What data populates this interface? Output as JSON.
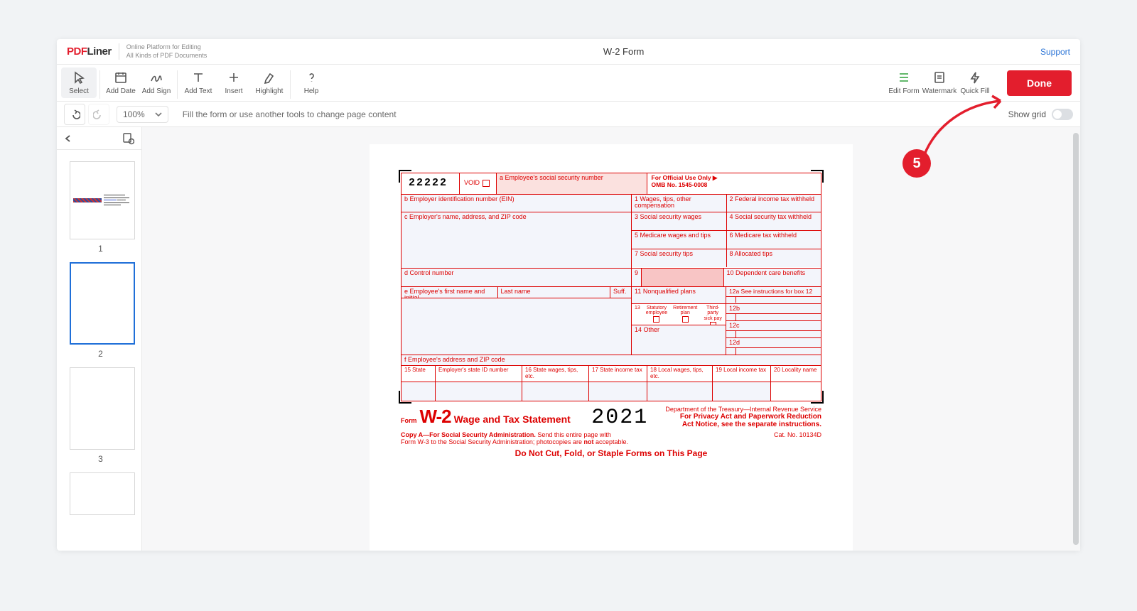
{
  "brand": {
    "p": "PDF",
    "l": "Liner",
    "sub1": "Online Platform for Editing",
    "sub2": "All Kinds of PDF Documents"
  },
  "title": "W-2 Form",
  "support": "Support",
  "toolbar": {
    "select": "Select",
    "addDate": "Add Date",
    "addSign": "Add Sign",
    "addText": "Add Text",
    "insert": "Insert",
    "highlight": "Highlight",
    "help": "Help",
    "editForm": "Edit Form",
    "watermark": "Watermark",
    "quickFill": "Quick Fill",
    "done": "Done"
  },
  "subbar": {
    "zoom": "100%",
    "hint": "Fill the form or use another tools to change page content",
    "showGrid": "Show grid"
  },
  "thumbs": {
    "p1": "1",
    "p2": "2",
    "p3": "3"
  },
  "annotation": {
    "num": "5"
  },
  "w2": {
    "num": "22222",
    "void": "VOID",
    "a": "a  Employee's social security number",
    "offUse": "For Official Use Only  ▶",
    "omb": "OMB No. 1545-0008",
    "b": "b  Employer identification number (EIN)",
    "l1": "1   Wages, tips, other compensation",
    "l2": "2   Federal income tax withheld",
    "c": "c  Employer's name, address, and ZIP code",
    "l3": "3   Social security wages",
    "l4": "4   Social security tax withheld",
    "l5": "5   Medicare wages and tips",
    "l6": "6   Medicare tax withheld",
    "l7": "7   Social security tips",
    "l8": "8   Allocated tips",
    "d": "d  Control number",
    "l9": "9",
    "l10": "10  Dependent care benefits",
    "e": "e  Employee's first name and initial",
    "eLast": "Last name",
    "eSuff": "Suff.",
    "l11": "11  Nonqualified plans",
    "l12a": "12a  See instructions for box 12",
    "l13": "13",
    "l13a": "Statutory employee",
    "l13b": "Retirement plan",
    "l13c": "Third-party sick pay",
    "l12b": "12b",
    "l14": "14  Other",
    "l12c": "12c",
    "l12d": "12d",
    "f": "f  Employee's address and ZIP code",
    "l15": "15  State",
    "l15b": "Employer's state ID number",
    "l16": "16  State wages, tips, etc.",
    "l17": "17  State income tax",
    "l18": "18  Local wages, tips, etc.",
    "l19": "19  Local income tax",
    "l20": "20  Locality name",
    "form": "Form",
    "w2t": "W-2",
    "wage": "Wage and Tax Statement",
    "year": "2021",
    "dept": "Department of the Treasury—Internal Revenue Service",
    "priv1": "For Privacy Act and Paperwork Reduction",
    "priv2": "Act Notice, see the separate instructions.",
    "copyA": "Copy A—For Social Security Administration.",
    "copyA2": " Send this entire page with",
    "copyA3": "Form W-3 to the Social Security Administration; photocopies are ",
    "copyA3b": "not",
    "copyA3c": " acceptable.",
    "cat": "Cat. No. 10134D",
    "noCut": "Do Not Cut, Fold, or Staple Forms on This Page"
  }
}
